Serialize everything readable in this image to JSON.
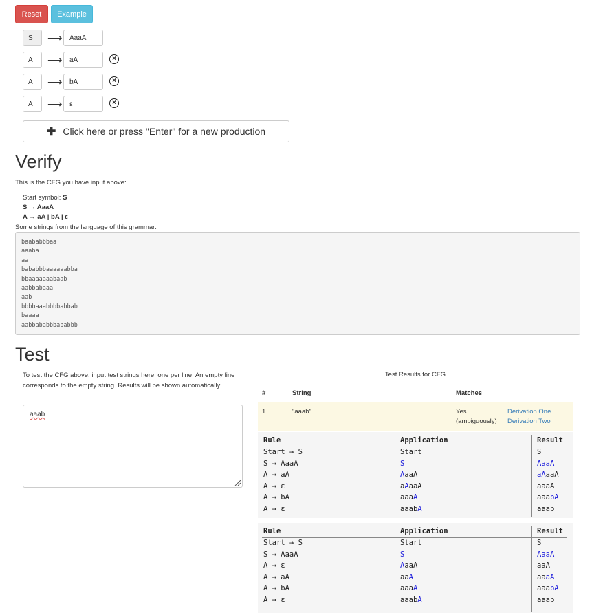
{
  "buttons": {
    "reset": "Reset",
    "example": "Example"
  },
  "productions": [
    {
      "lhs": "S",
      "rhs": "AaaA",
      "deletable": false
    },
    {
      "lhs": "A",
      "rhs": "aA",
      "deletable": true
    },
    {
      "lhs": "A",
      "rhs": "bA",
      "deletable": true
    },
    {
      "lhs": "A",
      "rhs": "ε",
      "deletable": true
    }
  ],
  "arrow_glyph": "⟶",
  "add_production_label": "Click here or press \"Enter\" for a new production",
  "verify": {
    "heading": "Verify",
    "intro": "This is the CFG you have input above:",
    "start_label": "Start symbol:",
    "start_symbol": "S",
    "rule1": "S → AaaA",
    "rule2": "A → aA | bA | ε",
    "strings_label": "Some strings from the language of this grammar:",
    "strings": [
      "baababbbaa",
      "aaaba",
      "aa",
      "bababbbaaaaaabba",
      "bbaaaaaaabaab",
      "aabbabaaa",
      "aab",
      "bbbbaaabbbbabbab",
      "baaaa",
      "aabbababbbababbb"
    ]
  },
  "test": {
    "heading": "Test",
    "instructions": "To test the CFG above, input test strings here, one per line. An empty line corresponds to the empty string. Results will be shown automatically.",
    "input_value": "aaab",
    "results_title": "Test Results for CFG",
    "col_num": "#",
    "col_string": "String",
    "col_matches": "Matches",
    "row": {
      "num": "1",
      "string": "\"aaab\"",
      "match": "Yes",
      "match_note": "(ambiguously)",
      "link1": "Derivation One",
      "link2": "Derivation Two"
    }
  },
  "derivation_headers": {
    "rule": "Rule",
    "application": "Application",
    "result": "Result"
  },
  "derivations": [
    [
      {
        "rule": "Start → S",
        "app": [
          [
            "Start",
            false
          ]
        ],
        "res": [
          [
            "S",
            false
          ]
        ]
      },
      {
        "rule": "S → AaaA",
        "app": [
          [
            "S",
            true
          ]
        ],
        "res": [
          [
            "AaaA",
            true
          ]
        ]
      },
      {
        "rule": "A → aA",
        "app": [
          [
            "A",
            true
          ],
          [
            "aaA",
            false
          ]
        ],
        "res": [
          [
            "aA",
            true
          ],
          [
            "aaA",
            false
          ]
        ]
      },
      {
        "rule": "A → ε",
        "app": [
          [
            "a",
            false
          ],
          [
            "A",
            true
          ],
          [
            "aaA",
            false
          ]
        ],
        "res": [
          [
            "aaaA",
            false
          ]
        ]
      },
      {
        "rule": "A → bA",
        "app": [
          [
            "aaa",
            false
          ],
          [
            "A",
            true
          ]
        ],
        "res": [
          [
            "aaa",
            false
          ],
          [
            "bA",
            true
          ]
        ]
      },
      {
        "rule": "A → ε",
        "app": [
          [
            "aaab",
            false
          ],
          [
            "A",
            true
          ]
        ],
        "res": [
          [
            "aaab",
            false
          ]
        ]
      }
    ],
    [
      {
        "rule": "Start → S",
        "app": [
          [
            "Start",
            false
          ]
        ],
        "res": [
          [
            "S",
            false
          ]
        ]
      },
      {
        "rule": "S → AaaA",
        "app": [
          [
            "S",
            true
          ]
        ],
        "res": [
          [
            "AaaA",
            true
          ]
        ]
      },
      {
        "rule": "A → ε",
        "app": [
          [
            "A",
            true
          ],
          [
            "aaA",
            false
          ]
        ],
        "res": [
          [
            "aaA",
            false
          ]
        ]
      },
      {
        "rule": "A → aA",
        "app": [
          [
            "aa",
            false
          ],
          [
            "A",
            true
          ]
        ],
        "res": [
          [
            "aa",
            false
          ],
          [
            "aA",
            true
          ]
        ]
      },
      {
        "rule": "A → bA",
        "app": [
          [
            "aaa",
            false
          ],
          [
            "A",
            true
          ]
        ],
        "res": [
          [
            "aaa",
            false
          ],
          [
            "bA",
            true
          ]
        ]
      },
      {
        "rule": "A → ε",
        "app": [
          [
            "aaab",
            false
          ],
          [
            "A",
            true
          ]
        ],
        "res": [
          [
            "aaab",
            false
          ]
        ]
      }
    ]
  ]
}
